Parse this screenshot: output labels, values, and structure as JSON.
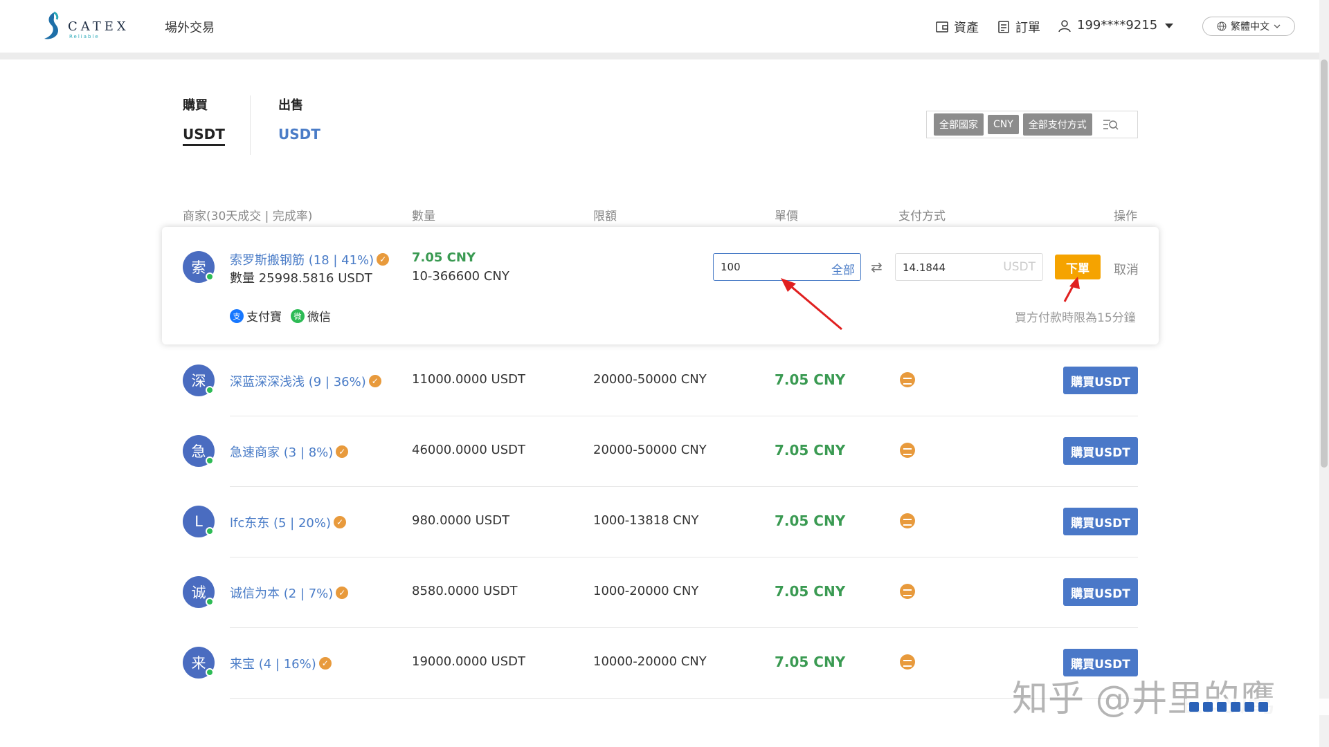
{
  "header": {
    "logo_text": "CATEX",
    "logo_sub": "Reliable",
    "nav_otc": "場外交易",
    "assets": "資產",
    "orders": "訂單",
    "user": "199****9215",
    "language": "繁體中文"
  },
  "tabs": {
    "buy_title": "購買",
    "buy_coin": "USDT",
    "sell_title": "出售",
    "sell_coin": "USDT"
  },
  "filters": {
    "country": "全部國家",
    "currency": "CNY",
    "payment": "全部支付方式"
  },
  "columns": {
    "merchant": "商家(30天成交 | 完成率)",
    "quantity": "數量",
    "limit": "限額",
    "price": "單價",
    "payment": "支付方式",
    "action": "操作"
  },
  "expanded": {
    "avatar": "索",
    "merchant": "索罗斯搬钢筋 (18 | 41%)",
    "quantity": "數量 25998.5816 USDT",
    "price": "7.05 CNY",
    "limit": "10-366600 CNY",
    "amount_value": "100",
    "all_label": "全部",
    "usdt_value": "14.1844",
    "usdt_unit": "USDT",
    "order_label": "下單",
    "cancel_label": "取消",
    "deadline": "買方付款時限為15分鐘",
    "pay_alipay": "支付寶",
    "pay_wechat": "微信",
    "alipay_glyph": "支",
    "wechat_glyph": "微"
  },
  "rows": [
    {
      "avatar": "深",
      "merchant": "深蓝深深浅浅 (9 | 36%)",
      "quantity": "11000.0000 USDT",
      "limit": "20000-50000 CNY",
      "price": "7.05 CNY",
      "button": "購買USDT"
    },
    {
      "avatar": "急",
      "merchant": "急速商家 (3 | 8%)",
      "quantity": "46000.0000 USDT",
      "limit": "20000-50000 CNY",
      "price": "7.05 CNY",
      "button": "購買USDT"
    },
    {
      "avatar": "L",
      "merchant": "lfc东东 (5 | 20%)",
      "quantity": "980.0000 USDT",
      "limit": "1000-13818 CNY",
      "price": "7.05 CNY",
      "button": "購買USDT"
    },
    {
      "avatar": "诚",
      "merchant": "诚信为本 (2 | 7%)",
      "quantity": "8580.0000 USDT",
      "limit": "1000-20000 CNY",
      "price": "7.05 CNY",
      "button": "購買USDT"
    },
    {
      "avatar": "来",
      "merchant": "来宝 (4 | 16%)",
      "quantity": "19000.0000 USDT",
      "limit": "10000-20000 CNY",
      "price": "7.05 CNY",
      "button": "購買USDT"
    }
  ],
  "watermark": "知乎 @井里的鹰",
  "colors": {
    "accent_blue": "#4a7cc7",
    "price_green": "#3a9a52",
    "order_orange": "#f5a300",
    "buy_button": "#4a78c8",
    "annotation_red": "#e02020"
  }
}
